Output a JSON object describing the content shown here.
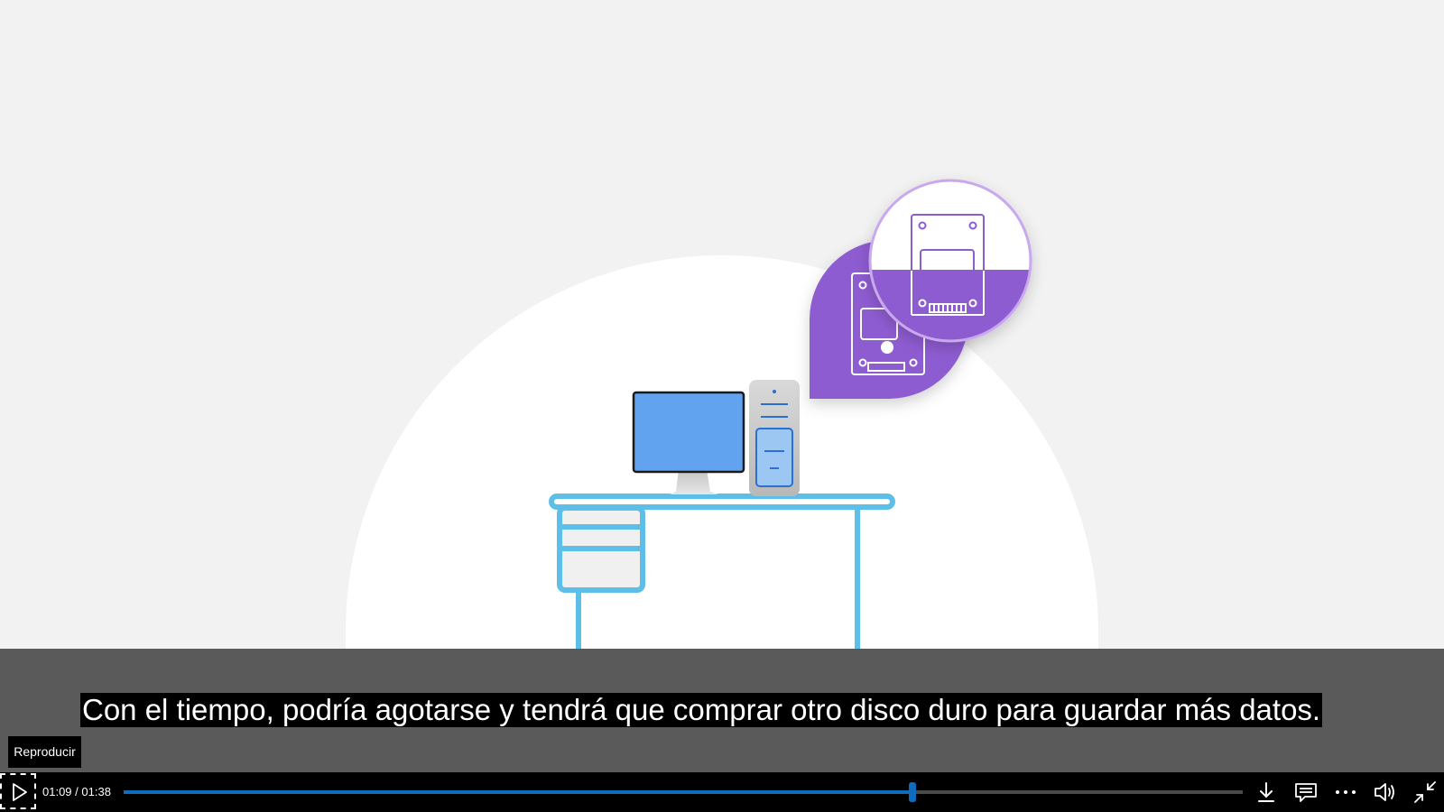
{
  "caption": {
    "text": "Con el tiempo, podría agotarse y tendrá que comprar otro disco duro para guardar más datos."
  },
  "tooltip": {
    "label": "Reproducir"
  },
  "player": {
    "current_time": "01:09",
    "separator": " / ",
    "duration": "01:38",
    "progress_fraction": 0.705,
    "accent_color": "#0f6cbd",
    "icons": [
      "play-icon",
      "download-icon",
      "captions-icon",
      "more-options-icon",
      "volume-icon",
      "exit-fullscreen-icon"
    ]
  },
  "colors": {
    "background": "#f2f2f2",
    "monitor_screen": "#62a3ef",
    "desk_outline": "#5dbfe8",
    "drive_purple": "#8e5cd1"
  }
}
